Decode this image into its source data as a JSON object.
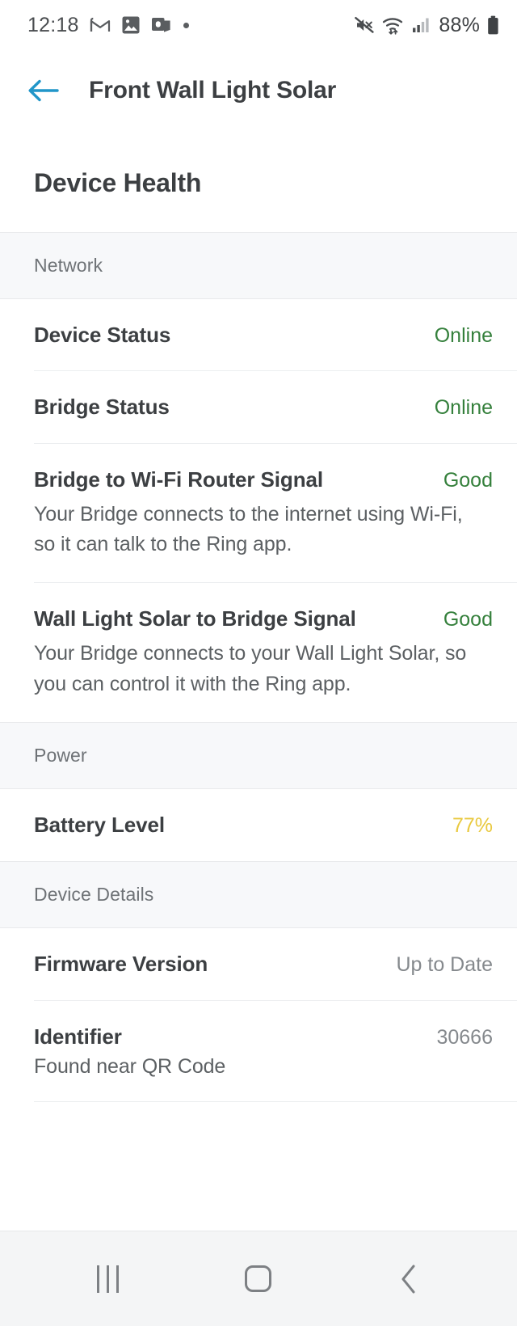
{
  "status_bar": {
    "time": "12:18",
    "battery_text": "88%",
    "left_icons": [
      "gmail-icon",
      "photos-icon",
      "outlook-icon",
      "notification-dot"
    ],
    "right_icons": [
      "mute-icon",
      "wifi-icon",
      "cellular-signal-icon",
      "battery-icon"
    ]
  },
  "app_bar": {
    "back_icon": "arrow-left-icon",
    "title": "Front Wall Light Solar",
    "accent_color": "#2196c9"
  },
  "page": {
    "title": "Device Health"
  },
  "sections": [
    {
      "title": "Network",
      "rows": [
        {
          "label": "Device Status",
          "value": "Online",
          "value_color": "#35803c",
          "desc": ""
        },
        {
          "label": "Bridge Status",
          "value": "Online",
          "value_color": "#35803c",
          "desc": ""
        },
        {
          "label": "Bridge to Wi-Fi Router Signal",
          "value": "Good",
          "value_color": "#35803c",
          "desc": "Your Bridge connects to the internet using Wi-Fi, so it can talk to the Ring app."
        },
        {
          "label": "Wall Light Solar to Bridge Signal",
          "value": "Good",
          "value_color": "#35803c",
          "desc": "Your Bridge connects to your Wall Light Solar, so you can control it with the Ring app."
        }
      ]
    },
    {
      "title": "Power",
      "rows": [
        {
          "label": "Battery Level",
          "value": "77%",
          "value_color": "#e9c93f",
          "desc": ""
        }
      ]
    },
    {
      "title": "Device Details",
      "rows": [
        {
          "label": "Firmware Version",
          "value": "Up to Date",
          "value_color": "#85898d",
          "desc": ""
        },
        {
          "label": "Identifier",
          "value": "30666",
          "value_color": "#85898d",
          "desc": "Found near QR Code"
        }
      ]
    }
  ],
  "nav_bar": {
    "recents_label": "recents-icon",
    "home_label": "home-icon",
    "back_label": "back-icon"
  }
}
